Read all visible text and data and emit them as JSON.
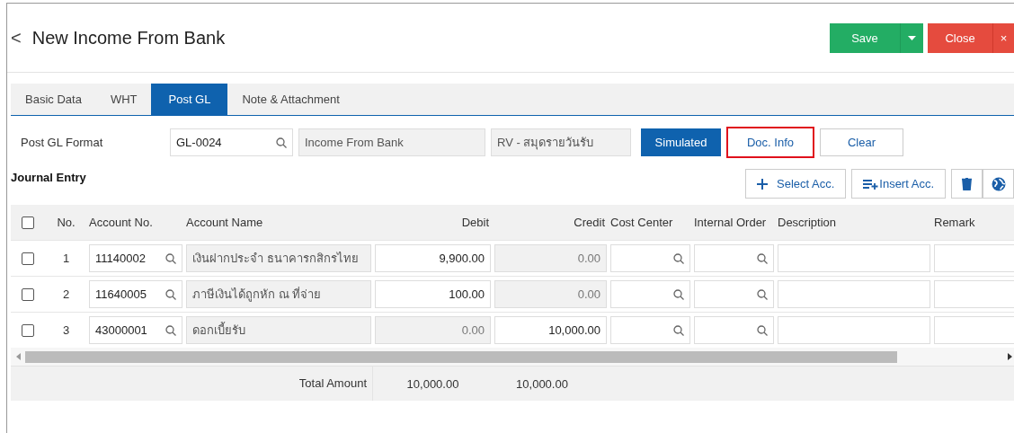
{
  "header": {
    "back": "<",
    "title": "New Income From Bank",
    "save": "Save",
    "close": "Close",
    "close_x": "×"
  },
  "tabs": [
    {
      "label": "Basic Data",
      "selected": false
    },
    {
      "label": "WHT",
      "selected": false
    },
    {
      "label": "Post GL",
      "selected": true
    },
    {
      "label": "Note & Attachment",
      "selected": false
    }
  ],
  "post_gl": {
    "label": "Post GL Format",
    "code": "GL-0024",
    "name": "Income From Bank",
    "book": "RV - สมุดรายวันรับ",
    "buttons": [
      {
        "label": "Simulated",
        "kind": "primary",
        "highlighted": false
      },
      {
        "label": "Doc. Info",
        "kind": "plain",
        "highlighted": true
      },
      {
        "label": "Clear",
        "kind": "plain",
        "highlighted": false
      }
    ]
  },
  "journal": {
    "title": "Journal Entry",
    "select_acc": "Select Acc.",
    "insert_acc": "Insert Acc."
  },
  "table": {
    "columns": [
      "No.",
      "Account No.",
      "Account Name",
      "Debit",
      "Credit",
      "Cost Center",
      "Internal Order",
      "Description",
      "Remark"
    ],
    "header_checked": false,
    "rows": [
      {
        "checked": false,
        "no": "1",
        "account_no": "11140002",
        "account_name": "เงินฝากประจำ ธนาคารกสิกรไทย",
        "debit": {
          "value": "9,900.00",
          "disabled": false
        },
        "credit": {
          "value": "0.00",
          "disabled": true
        }
      },
      {
        "checked": false,
        "no": "2",
        "account_no": "11640005",
        "account_name": "ภาษีเงินได้ถูกหัก ณ ที่จ่าย",
        "debit": {
          "value": "100.00",
          "disabled": false
        },
        "credit": {
          "value": "0.00",
          "disabled": true
        }
      },
      {
        "checked": false,
        "no": "3",
        "account_no": "43000001",
        "account_name": "ดอกเบี้ยรับ",
        "debit": {
          "value": "0.00",
          "disabled": true
        },
        "credit": {
          "value": "10,000.00",
          "disabled": false
        }
      }
    ],
    "total_label": "Total Amount",
    "total_debit": "10,000.00",
    "total_credit": "10,000.00"
  }
}
